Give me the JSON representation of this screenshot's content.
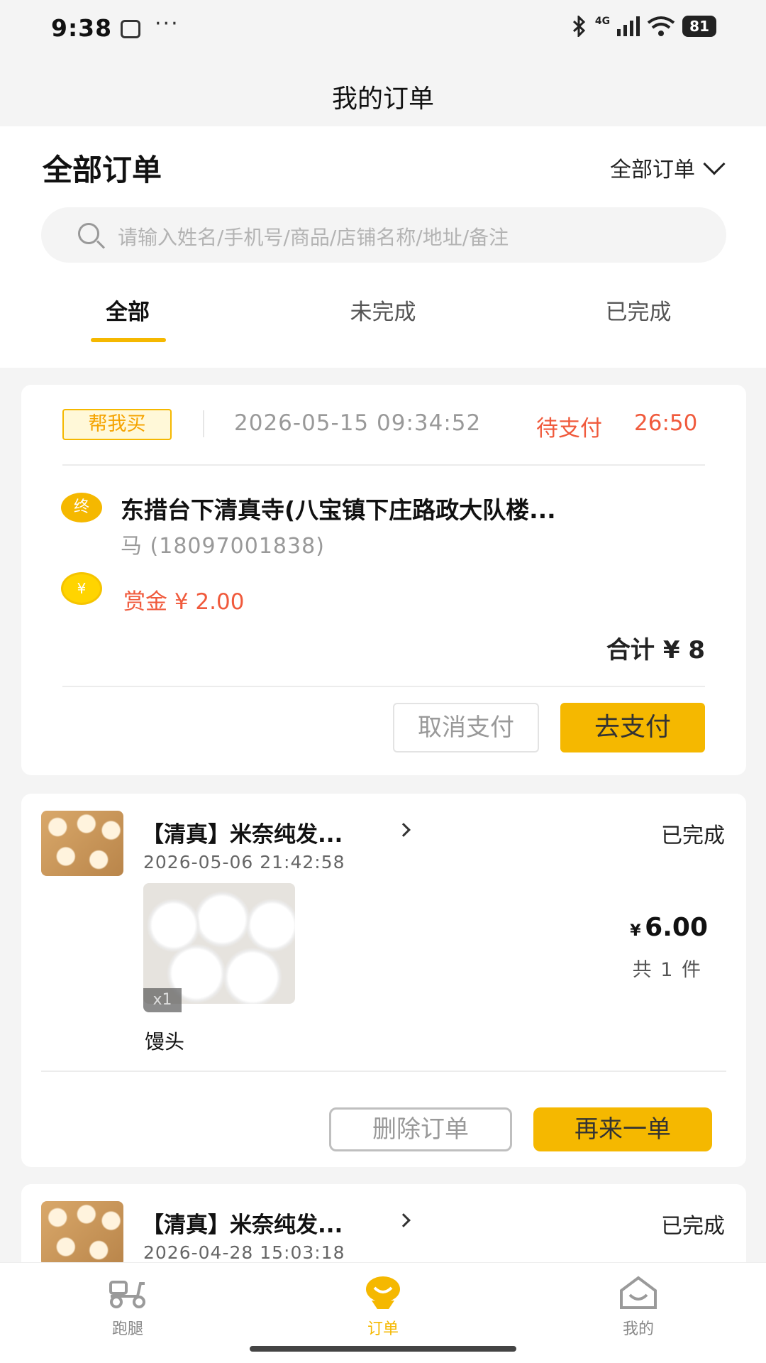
{
  "status_bar": {
    "time": "9:38",
    "dots": "···",
    "network": "4G",
    "battery": "81"
  },
  "title": "我的订单",
  "header": {
    "heading": "全部订单",
    "filter_label": "全部订单",
    "search_placeholder": "请输入姓名/手机号/商品/店铺名称/地址/备注"
  },
  "tabs": [
    {
      "label": "全部",
      "active": true
    },
    {
      "label": "未完成",
      "active": false
    },
    {
      "label": "已完成",
      "active": false
    }
  ],
  "errand_order": {
    "tag": "帮我买",
    "time": "2026-05-15 09:34:52",
    "status": "待支付",
    "countdown": "26:50",
    "end_badge": "终",
    "address": "东措台下清真寺(八宝镇下庄路政大队楼...",
    "contact": "马 (18097001838)",
    "coin_symbol": "¥",
    "bounty": "赏金 ¥ 2.00",
    "total": "合计 ¥ 8",
    "cancel_label": "取消支付",
    "pay_label": "去支付"
  },
  "orders": [
    {
      "shop": "【清真】米奈纯发...",
      "status": "已完成",
      "date": "2026-05-06 21:42:58",
      "product_name": "馒头",
      "qty": "x1",
      "price_symbol": "¥",
      "price": "6.00",
      "piece_count": "共 1 件",
      "delete_label": "删除订单",
      "reorder_label": "再来一单"
    },
    {
      "shop": "【清真】米奈纯发...",
      "status": "已完成",
      "date": "2026-04-28 15:03:18"
    }
  ],
  "bottom_nav": [
    {
      "label": "跑腿",
      "icon": "scooter-icon",
      "active": false
    },
    {
      "label": "订单",
      "icon": "order-smile-icon",
      "active": true
    },
    {
      "label": "我的",
      "icon": "home-smile-icon",
      "active": false
    }
  ],
  "colors": {
    "accent": "#f5b800",
    "alert": "#f05a3c"
  }
}
